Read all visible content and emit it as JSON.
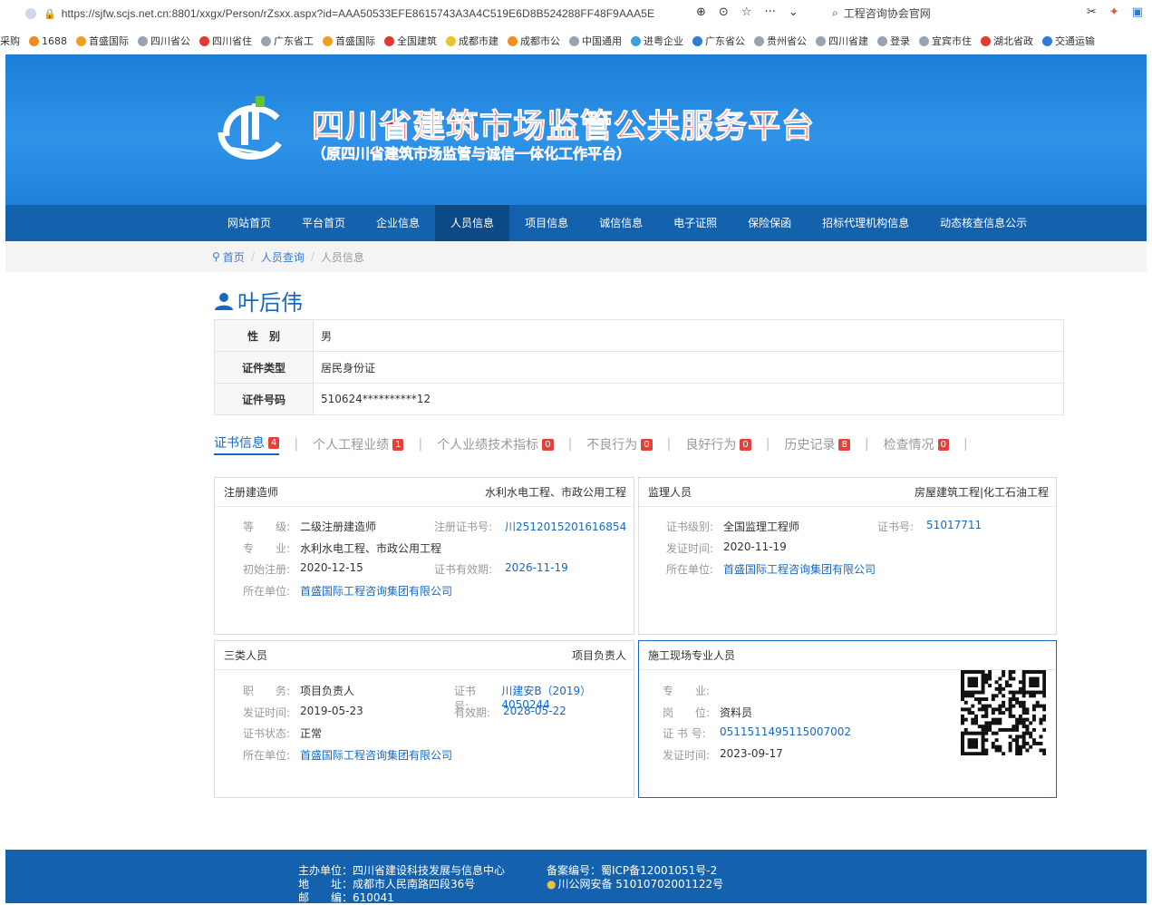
{
  "browser": {
    "url": "https://sjfw.scjs.net.cn:8801/xxgx/Person/rZsxx.aspx?id=AAA50533EFE8615743A3A4C519E6D8B524288FF48F9AAA5E",
    "search_text": "工程咨询协会官网",
    "bookmarks": [
      "采购",
      "1688",
      "首盛国际",
      "四川省公",
      "四川省住",
      "广东省工",
      "首盛国际",
      "全国建筑",
      "成都市建",
      "成都市公",
      "中国通用",
      "进粤企业",
      "广东省公",
      "贵州省公",
      "四川省建",
      "登录",
      "宜宾市住",
      "湖北省政",
      "交通运输"
    ]
  },
  "header": {
    "title": "四川省建筑市场监管公共服务平台",
    "subtitle": "（原四川省建筑市场监管与诚信一体化工作平台）"
  },
  "nav": {
    "items": [
      "网站首页",
      "平台首页",
      "企业信息",
      "人员信息",
      "项目信息",
      "诚信信息",
      "电子证照",
      "保险保函",
      "招标代理机构信息",
      "动态核查信息公示"
    ],
    "active_index": 3
  },
  "breadcrumb": {
    "home": "首页",
    "query": "人员查询",
    "current": "人员信息"
  },
  "person": {
    "name": "叶后伟",
    "rows": [
      {
        "label": "性　别",
        "value": "男"
      },
      {
        "label": "证件类型",
        "value": "居民身份证"
      },
      {
        "label": "证件号码",
        "value": "510624**********12"
      }
    ]
  },
  "tabs": [
    {
      "label": "证书信息",
      "count": "4"
    },
    {
      "label": "个人工程业绩",
      "count": "1"
    },
    {
      "label": "个人业绩技术指标",
      "count": "0"
    },
    {
      "label": "不良行为",
      "count": "0"
    },
    {
      "label": "良好行为",
      "count": "0"
    },
    {
      "label": "历史记录",
      "count": "8"
    },
    {
      "label": "检查情况",
      "count": "0"
    }
  ],
  "cards": {
    "c1": {
      "title": "注册建造师",
      "right": "水利水电工程、市政公用工程",
      "grade_label": "等　　级:",
      "grade": "二级注册建造师",
      "certno_label": "注册证书号:",
      "certno": "川2512015201616854",
      "major_label": "专　　业:",
      "major": "水利水电工程、市政公用工程",
      "init_label": "初始注册:",
      "init": "2020-12-15",
      "valid_label": "证书有效期:",
      "valid": "2026-11-19",
      "unit_label": "所在单位:",
      "unit": "首盛国际工程咨询集团有限公司"
    },
    "c2": {
      "title": "监理人员",
      "right": "房屋建筑工程|化工石油工程",
      "level_label": "证书级别:",
      "level": "全国监理工程师",
      "no_label": "证书号:",
      "no": "51017711",
      "date_label": "发证时间:",
      "date": "2020-11-19",
      "unit_label": "所在单位:",
      "unit": "首盛国际工程咨询集团有限公司"
    },
    "c3": {
      "title": "三类人员",
      "right": "项目负责人",
      "job_label": "职　　务:",
      "job": "项目负责人",
      "no_label": "证书号:",
      "no": "川建安B（2019）4050244",
      "date_label": "发证时间:",
      "date": "2019-05-23",
      "valid_label": "有效期:",
      "valid": "2028-05-22",
      "status_label": "证书状态:",
      "status": "正常",
      "unit_label": "所在单位:",
      "unit": "首盛国际工程咨询集团有限公司"
    },
    "c4": {
      "title": "施工现场专业人员",
      "major_label": "专　　业:",
      "major": "",
      "post_label": "岗　　位:",
      "post": "资料员",
      "no_label": "证 书 号:",
      "no": "0511511495115007002",
      "date_label": "发证时间:",
      "date": "2023-09-17"
    }
  },
  "footer": {
    "host": "主办单位：四川省建设科技发展与信息中心",
    "addr": "地　　址：成都市人民南路四段36号",
    "zip": "邮　　编：610041",
    "icp": "备案编号：蜀ICP备12001051号-2",
    "police": "川公网安备 51010702001122号"
  }
}
